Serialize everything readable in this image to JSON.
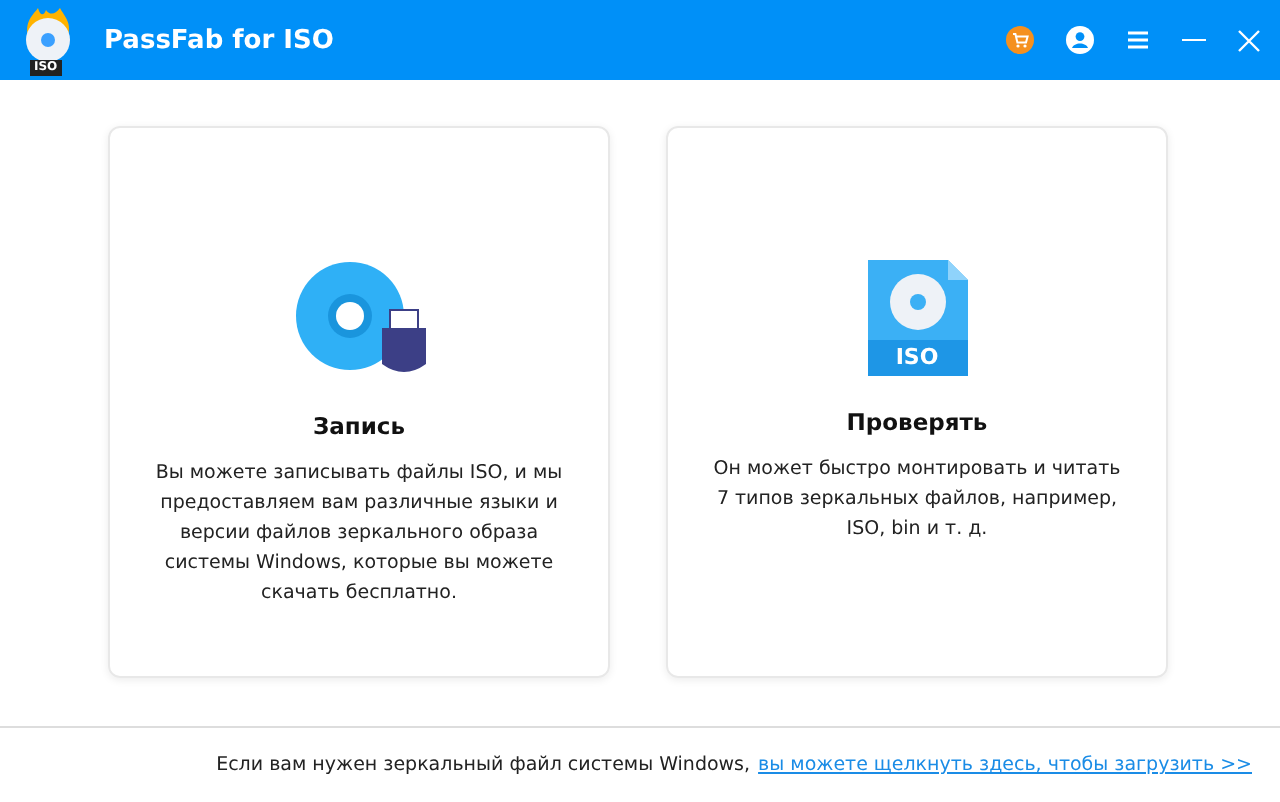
{
  "window": {
    "title": "PassFab for ISO",
    "logo_text": "ISO"
  },
  "cards": [
    {
      "kind": "burn",
      "title": "Запись",
      "text": "Вы можете записывать файлы ISO, и мы предоставляем вам различные языки и версии файлов зеркального образа системы Windows, которые вы можете скачать бесплатно."
    },
    {
      "kind": "mount",
      "icon_text": "ISO",
      "title": "Проверять",
      "text": "Он может быстро монтировать и читать 7 типов зеркальных файлов, например, ISO, bin и т. д."
    }
  ],
  "footer": {
    "text": "Если вам нужен зеркальный файл  системы Windows,",
    "link": "вы можете щелкнуть здесь, чтобы загрузить >>"
  }
}
